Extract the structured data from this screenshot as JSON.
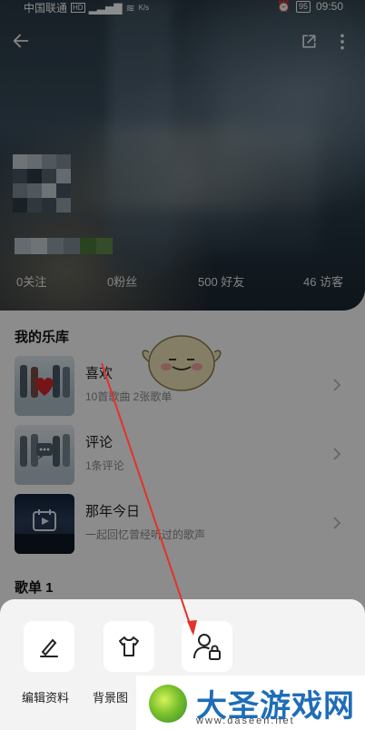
{
  "status_bar": {
    "carrier": "中国联通",
    "network_badge": "HD",
    "speed_unit": "K/s",
    "battery": "95",
    "time": "09:50"
  },
  "profile": {
    "stats": [
      {
        "label": "0关注"
      },
      {
        "label": "0粉丝"
      },
      {
        "label": "500 好友"
      },
      {
        "label": "46 访客"
      }
    ]
  },
  "library": {
    "title": "我的乐库",
    "items": [
      {
        "title": "喜欢",
        "subtitle": "10首歌曲 2张歌单",
        "icon": "heart-icon"
      },
      {
        "title": "评论",
        "subtitle": "1条评论",
        "icon": "comment-icon"
      },
      {
        "title": "那年今日",
        "subtitle": "一起回忆曾经听过的歌声",
        "icon": "calendar-play-icon"
      }
    ]
  },
  "playlist_section": {
    "title": "歌单 1"
  },
  "bottom_sheet": {
    "actions": [
      {
        "label": "编辑资料",
        "icon": "edit-pen-icon"
      },
      {
        "label": "背景图",
        "icon": "tshirt-icon"
      },
      {
        "label": "",
        "icon": "user-lock-icon"
      }
    ]
  },
  "watermark": {
    "title": "大圣游戏网",
    "url": "www.daseen.net"
  },
  "colors": {
    "annotation_arrow": "#e3322b",
    "watermark_blue": "#1e6db8"
  }
}
